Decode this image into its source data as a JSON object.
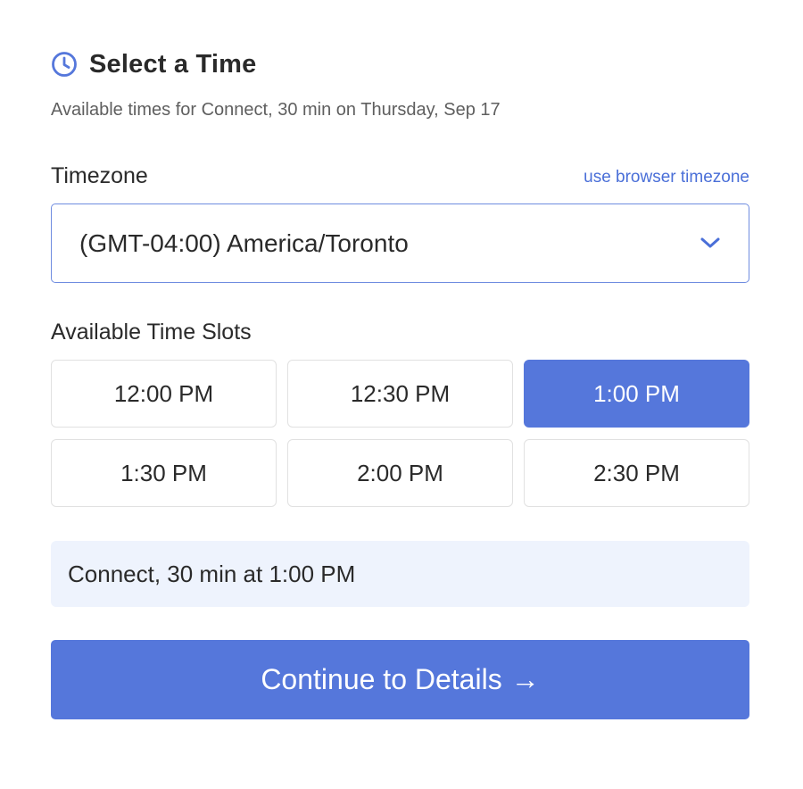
{
  "header": {
    "title": "Select a Time",
    "subtitle": "Available times for Connect, 30 min on Thursday, Sep 17",
    "icon": "clock-icon"
  },
  "timezone": {
    "label": "Timezone",
    "browser_link": "use browser timezone",
    "selected": "(GMT-04:00) America/Toronto"
  },
  "slots": {
    "label": "Available Time Slots",
    "items": [
      {
        "label": "12:00 PM",
        "selected": false
      },
      {
        "label": "12:30 PM",
        "selected": false
      },
      {
        "label": "1:00 PM",
        "selected": true
      },
      {
        "label": "1:30 PM",
        "selected": false
      },
      {
        "label": "2:00 PM",
        "selected": false
      },
      {
        "label": "2:30 PM",
        "selected": false
      }
    ]
  },
  "summary": {
    "text": "Connect, 30 min at 1:00 PM"
  },
  "continue_button": {
    "label": "Continue to Details",
    "arrow": "→"
  },
  "colors": {
    "accent": "#5577db",
    "link": "#4a6fd8",
    "summary_bg": "#eef3fd"
  }
}
